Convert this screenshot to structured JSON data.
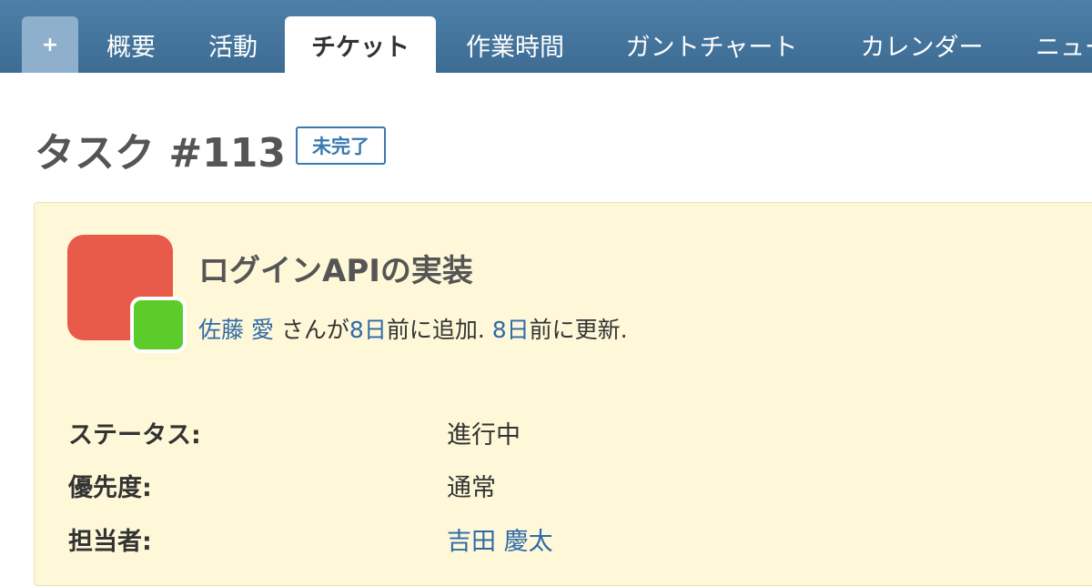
{
  "tabs": {
    "new_label": "+",
    "items": [
      {
        "label": "概要"
      },
      {
        "label": "活動"
      },
      {
        "label": "チケット"
      },
      {
        "label": "作業時間"
      },
      {
        "label": "ガントチャート"
      },
      {
        "label": "カレンダー"
      },
      {
        "label": "ニュース"
      }
    ],
    "active_index": 2
  },
  "issue": {
    "title": "タスク #113",
    "status_badge": "未完了",
    "subject": "ログインAPIの実装",
    "author": "佐藤 愛",
    "author_suffix": "さんが",
    "added_ago": "8日",
    "added_text": "前に追加.",
    "updated_ago": "8日",
    "updated_text": "前に更新.",
    "attributes": [
      {
        "label": "ステータス:",
        "value": "進行中"
      },
      {
        "label": "優先度:",
        "value": "通常"
      },
      {
        "label": "担当者:",
        "value": "吉田 慶太"
      }
    ]
  },
  "colors": {
    "tab_bar": "#46769f",
    "link": "#2f6aa8",
    "issue_background": "#fef8d8",
    "avatar_main": "#e85a4a",
    "avatar_small": "#5dcc2a"
  }
}
